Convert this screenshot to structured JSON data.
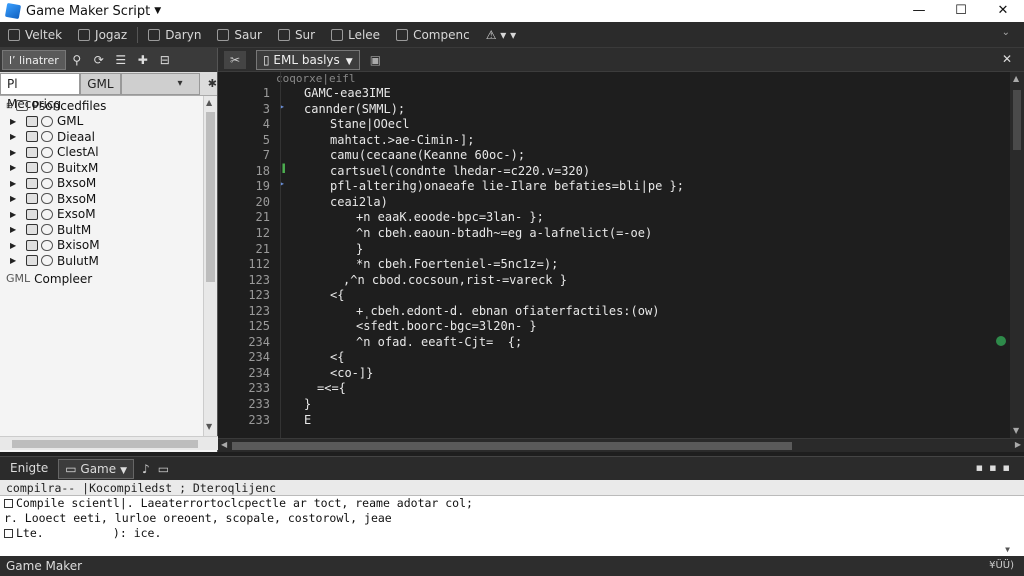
{
  "window": {
    "title": "Game Maker Script",
    "controls": [
      "—",
      "☐",
      "✕"
    ]
  },
  "menubar": {
    "items": [
      "Veltek",
      "Jogaz",
      "Daryn",
      "Saur",
      "Sur",
      "Lelee",
      "Compenc"
    ]
  },
  "left_panel": {
    "top_tab": "l’ linatrer",
    "tabs": [
      "Pl Mecoricg",
      "GML"
    ],
    "tree_root": "Psoncedfiles",
    "tree_items": [
      "GML",
      "Dieaal",
      "ClestAl",
      "BuitxM",
      "BxsoM",
      "BxsoM",
      "ExsoM",
      "BultM",
      "BxisoM",
      "BulutM"
    ],
    "compiler_label": "Compleer",
    "compiler_prefix": "GML"
  },
  "editor": {
    "tab_label": "EML baslys",
    "header": "coqorxe|eifl",
    "lines": [
      {
        "n": "1",
        "t": "GAMC-eae3IME"
      },
      {
        "n": "3",
        "t": "cannder(SMML);"
      },
      {
        "n": "4",
        "t": "Stane|OOecl"
      },
      {
        "n": "5",
        "t": "mahtact.>ae-Cimin-];"
      },
      {
        "n": "7",
        "t": "camu(cecaane(Keanne 60oc-);"
      },
      {
        "n": "18",
        "t": "cartsuel(condnte lhedar-=c220.v=320)"
      },
      {
        "n": "19",
        "t": "pfl-alterihg)onaeafe lie-Ilare befaties=bli|pe };"
      },
      {
        "n": "20",
        "t": "ceai2la)"
      },
      {
        "n": "21",
        "t": "+n eaaK.eoode-bpc=3lan- };"
      },
      {
        "n": "12",
        "t": "^n cbeh.eaoun-btadh~=eg a-lafnelict(=-oe)"
      },
      {
        "n": "21",
        "t": "}"
      },
      {
        "n": "112",
        "t": "*n cbeh.Foerteniel-=5nc1z=);"
      },
      {
        "n": "123",
        "t": ",^n cbod.cocsoun,rist-=vareck }"
      },
      {
        "n": "123",
        "t": "<{"
      },
      {
        "n": "123",
        "t": "+̩ cbeh.edont-d. ebnan ofiaterfactiles:(ow)"
      },
      {
        "n": "125",
        "t": "<sfedt.boorc-bgc=3l20n- }"
      },
      {
        "n": "234",
        "t": "^n ofad. eeaft-Cjt=  {;"
      },
      {
        "n": "234",
        "t": "<{"
      },
      {
        "n": "234",
        "t": "<co-]}"
      },
      {
        "n": "233",
        "t": "=<={"
      },
      {
        "n": "233",
        "t": "}"
      },
      {
        "n": "233",
        "t": "E"
      }
    ]
  },
  "bottom": {
    "tabs": [
      "Enigte",
      "Game"
    ],
    "header": "compilra-- |Kocompiledst ; Dteroqlijenc",
    "output_lines": [
      "Compile scientl|. Laeaterrortoclcpectle ar toct, reame adotar col;",
      "r. Looect eeti, lurloe oreoent, scopale, costorowl, jeae",
      "Lte.          ): ice."
    ]
  },
  "status": {
    "left": "Game Maker",
    "right": "¥ÜÜ)"
  }
}
